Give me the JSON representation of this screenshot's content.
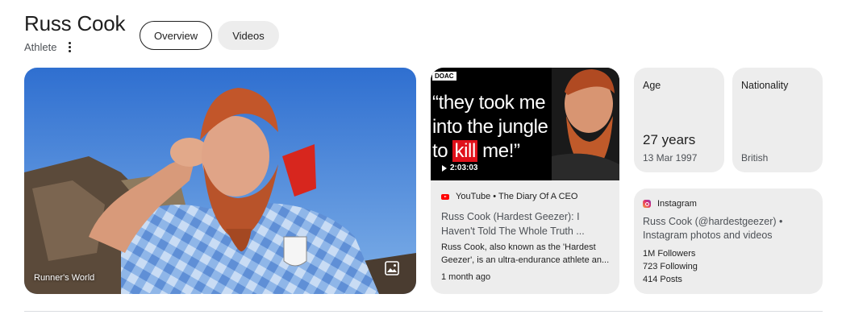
{
  "entity": {
    "name": "Russ Cook",
    "category": "Athlete"
  },
  "tabs": [
    {
      "label": "Overview",
      "active": true
    },
    {
      "label": "Videos",
      "active": false
    }
  ],
  "hero": {
    "credit": "Runner's World",
    "icon": "image-icon"
  },
  "video": {
    "badge": "DOAC",
    "thumb_line1": "“they took me",
    "thumb_line2": "into the jungle",
    "thumb_line3_pre": "to ",
    "thumb_line3_kill": "kill",
    "thumb_line3_post": " me!”",
    "duration": "2:03:03",
    "source": "YouTube • The Diary Of A CEO",
    "title": "Russ Cook (Hardest Geezer): I Haven't Told The Whole Truth ...",
    "description": "Russ Cook, also known as the 'Hardest Geezer', is an ultra-endurance athlete an...",
    "date": "1 month ago"
  },
  "age": {
    "label": "Age",
    "value": "27 years",
    "birthdate": "13 Mar 1997"
  },
  "nationality": {
    "label": "Nationality",
    "value": "British"
  },
  "instagram": {
    "source": "Instagram",
    "title": "Russ Cook (@hardestgeezer) • Instagram photos and videos",
    "followers": "1M Followers",
    "following": "723 Following",
    "posts": "414 Posts"
  },
  "colors": {
    "card_bg": "#ededed",
    "text_primary": "#1f1f1f",
    "text_secondary": "#4d5156",
    "youtube_red": "#ff0000",
    "kill_highlight": "#e0101a"
  }
}
